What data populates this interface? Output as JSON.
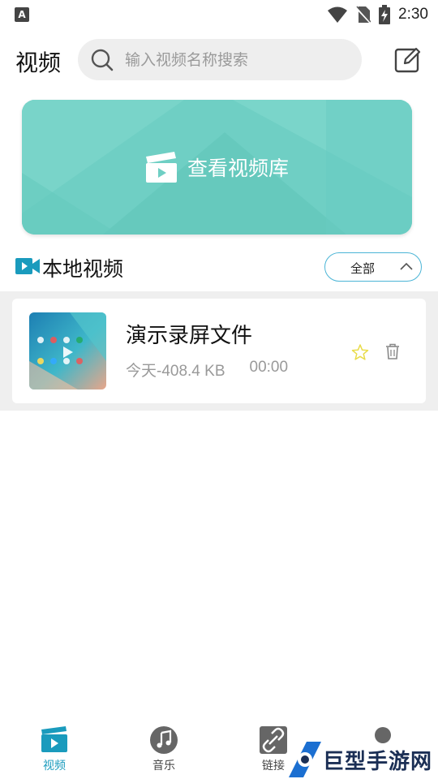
{
  "status": {
    "time": "2:30",
    "left_icon_letter": "A"
  },
  "header": {
    "title": "视频",
    "search_placeholder": "输入视频名称搜索"
  },
  "banner": {
    "label": "查看视频库",
    "color": "#6fcfc4"
  },
  "section": {
    "title": "本地视频",
    "filter_label": "全部",
    "accent": "#1a9bbd"
  },
  "videos": [
    {
      "title": "演示录屏文件",
      "meta": "今天-408.4 KB",
      "duration": "00:00",
      "favorite": false
    }
  ],
  "tabs": [
    {
      "label": "视频",
      "icon": "video-tab-icon",
      "active": true
    },
    {
      "label": "音乐",
      "icon": "music-tab-icon",
      "active": false
    },
    {
      "label": "链接",
      "icon": "link-tab-icon",
      "active": false
    },
    {
      "label": "",
      "icon": "profile-tab-icon",
      "active": false
    }
  ],
  "watermark": {
    "text": "巨型手游网"
  }
}
